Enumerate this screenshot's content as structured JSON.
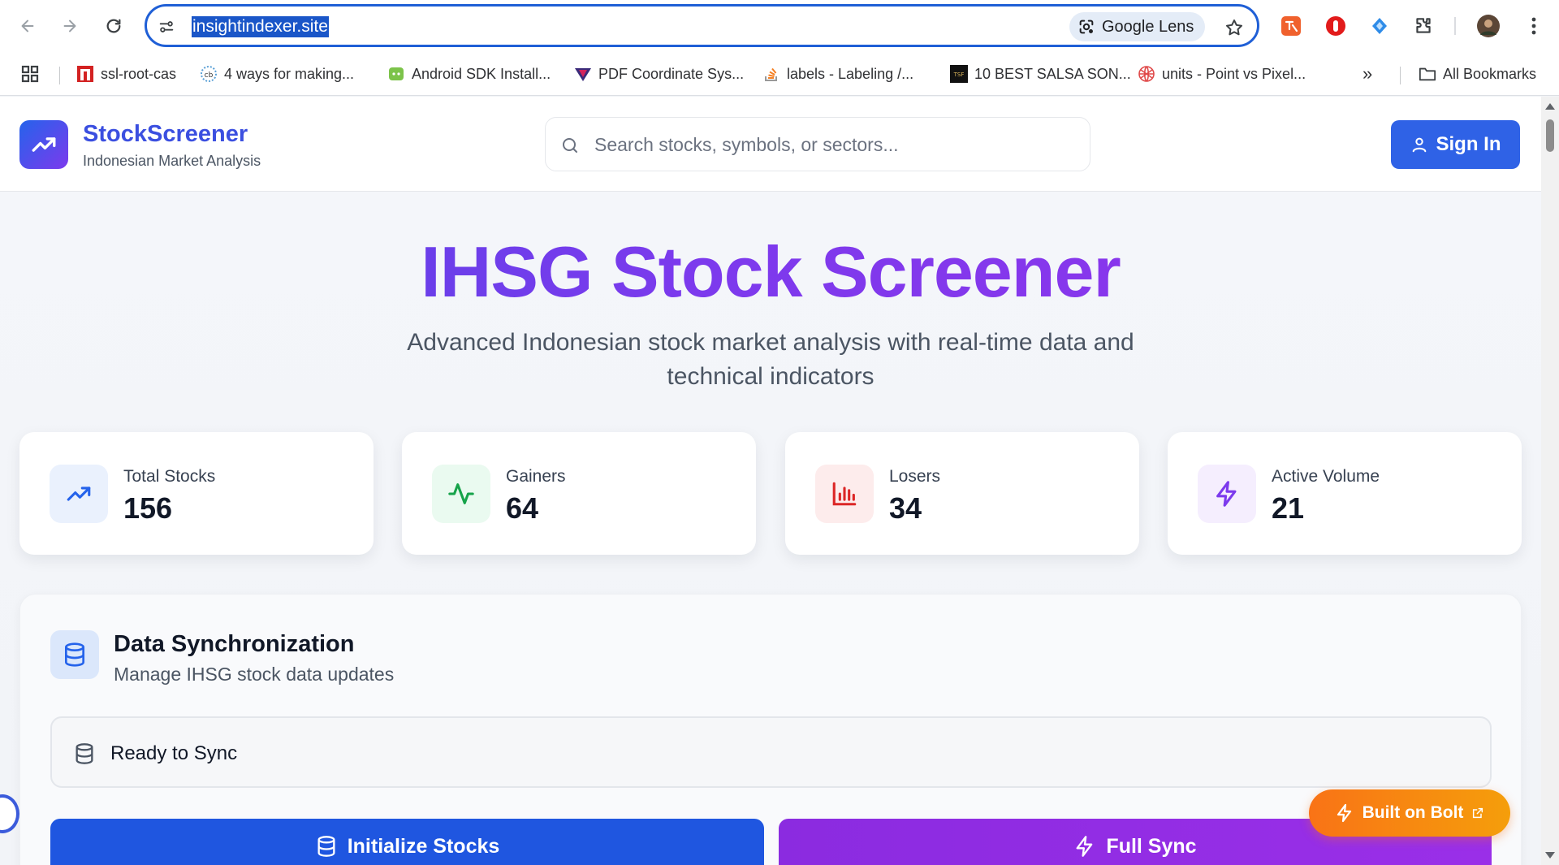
{
  "browser": {
    "url": "insightindexer.site",
    "lens_label": "Google Lens",
    "bookmarks": [
      {
        "label": "ssl-root-cas",
        "icon": "red-square-icon"
      },
      {
        "label": "4 ways for making...",
        "icon": "cb-logo-icon"
      },
      {
        "label": "Android SDK Install...",
        "icon": "android-icon"
      },
      {
        "label": "PDF Coordinate Sys...",
        "icon": "triangle-logo-icon"
      },
      {
        "label": "labels - Labeling /...",
        "icon": "stackoverflow-icon"
      },
      {
        "label": "10 BEST SALSA SON...",
        "icon": "tsf-logo-icon"
      },
      {
        "label": "units - Point vs Pixel...",
        "icon": "globe-icon"
      }
    ],
    "overflow_label": "»",
    "all_bookmarks_label": "All Bookmarks"
  },
  "header": {
    "brand_name": "StockScreener",
    "brand_sub": "Indonesian Market Analysis",
    "search_placeholder": "Search stocks, symbols, or sectors...",
    "signin_label": "Sign In"
  },
  "hero": {
    "title": "IHSG Stock Screener",
    "subtitle": "Advanced Indonesian stock market analysis with real-time data and technical indicators"
  },
  "stats": [
    {
      "label": "Total Stocks",
      "value": "156",
      "icon": "trending-up-icon",
      "color": "#2563eb"
    },
    {
      "label": "Gainers",
      "value": "64",
      "icon": "activity-icon",
      "color": "#16a34a"
    },
    {
      "label": "Losers",
      "value": "34",
      "icon": "bar-chart-icon",
      "color": "#dc2626"
    },
    {
      "label": "Active Volume",
      "value": "21",
      "icon": "zap-icon",
      "color": "#7c3aed"
    }
  ],
  "sync": {
    "title": "Data Synchronization",
    "subtitle": "Manage IHSG stock data updates",
    "status": "Ready to Sync",
    "init_label": "Initialize Stocks",
    "full_sync_label": "Full Sync"
  },
  "badge": {
    "label": "Built on Bolt"
  },
  "colors": {
    "primary": "#2f62e6",
    "accent_purple": "#9333ea",
    "badge_orange": "#f97316"
  }
}
